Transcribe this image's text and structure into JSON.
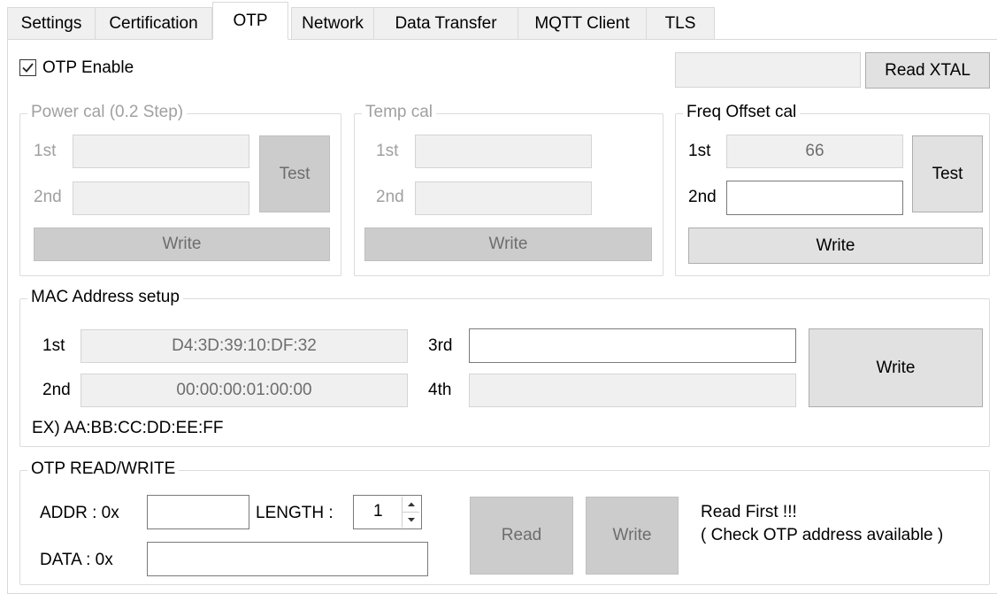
{
  "tabs": [
    {
      "label": "Settings"
    },
    {
      "label": "Certification"
    },
    {
      "label": "OTP"
    },
    {
      "label": "Network"
    },
    {
      "label": "Data Transfer"
    },
    {
      "label": "MQTT Client"
    },
    {
      "label": "TLS"
    }
  ],
  "otp_enable": {
    "label": "OTP Enable",
    "checked": true
  },
  "xtal": {
    "value": "",
    "button_label": "Read XTAL"
  },
  "power_cal": {
    "title": "Power cal (0.2 Step)",
    "first_label": "1st",
    "first_value": "",
    "second_label": "2nd",
    "second_value": "",
    "test_label": "Test",
    "write_label": "Write"
  },
  "temp_cal": {
    "title": "Temp cal",
    "first_label": "1st",
    "first_value": "",
    "second_label": "2nd",
    "second_value": "",
    "write_label": "Write"
  },
  "freq_cal": {
    "title": "Freq Offset cal",
    "first_label": "1st",
    "first_value": "66",
    "second_label": "2nd",
    "second_value": "",
    "test_label": "Test",
    "write_label": "Write"
  },
  "mac": {
    "title": "MAC Address setup",
    "first_label": "1st",
    "first_value": "D4:3D:39:10:DF:32",
    "second_label": "2nd",
    "second_value": "00:00:00:01:00:00",
    "third_label": "3rd",
    "third_value": "",
    "fourth_label": "4th",
    "fourth_value": "",
    "write_label": "Write",
    "example": "EX) AA:BB:CC:DD:EE:FF"
  },
  "otp_rw": {
    "title": "OTP READ/WRITE",
    "addr_label": "ADDR : 0x",
    "addr_value": "",
    "length_label": "LENGTH :",
    "length_value": "1",
    "data_label": "DATA : 0x",
    "data_value": "",
    "read_label": "Read",
    "write_label": "Write",
    "note_line1": "Read First !!!",
    "note_line2": "( Check OTP address available )"
  },
  "icons": {
    "check": "check-icon",
    "spin_up": "arrow-up-icon",
    "spin_down": "arrow-down-icon"
  }
}
